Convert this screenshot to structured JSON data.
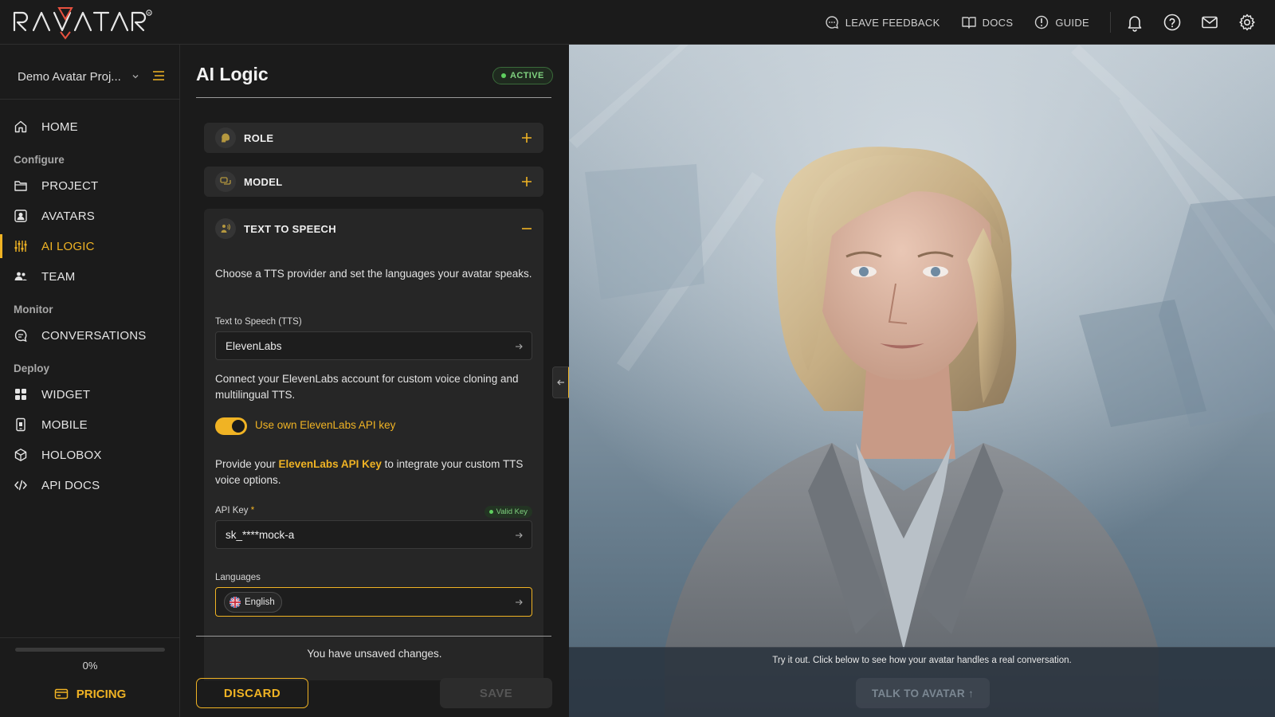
{
  "brand": {
    "logo_text": "RAVATAR",
    "accent": "#f0b324"
  },
  "topnav": {
    "feedback": "LEAVE FEEDBACK",
    "docs": "DOCS",
    "guide": "GUIDE",
    "icons": [
      "bell-icon",
      "help-icon",
      "mail-icon",
      "gear-icon"
    ]
  },
  "sidebar": {
    "project": "Demo Avatar Proj...",
    "home": "HOME",
    "sections": {
      "configure": "Configure",
      "monitor": "Monitor",
      "deploy": "Deploy"
    },
    "items": {
      "project": "PROJECT",
      "avatars": "AVATARS",
      "ai_logic": "AI LOGIC",
      "team": "TEAM",
      "conversations": "CONVERSATIONS",
      "widget": "WIDGET",
      "mobile": "MOBILE",
      "holobox": "HOLOBOX",
      "api_docs": "API DOCS"
    },
    "progress_value": 0,
    "progress_label": "0%",
    "pricing": "PRICING"
  },
  "panel": {
    "title": "AI Logic",
    "status": "ACTIVE",
    "role": "ROLE",
    "model": "MODEL",
    "tts": {
      "title": "TEXT TO SPEECH",
      "intro": "Choose a TTS provider and set the languages your avatar speaks.",
      "provider_label": "Text to Speech (TTS)",
      "provider_value": "ElevenLabs",
      "connect_text": "Connect your ElevenLabs account for custom voice cloning and multilingual TTS.",
      "toggle_label": "Use own ElevenLabs API key",
      "toggle_on": true,
      "provide_pre": "Provide your ",
      "provide_link": "ElevenLabs API Key",
      "provide_post": " to integrate your custom TTS voice options.",
      "api_key_label": "API Key",
      "required_mark": "*",
      "valid_badge": "Valid Key",
      "api_key_value": "sk_****mock-a",
      "languages_label": "Languages",
      "language_chip": "English"
    },
    "unsaved": "You have unsaved changes.",
    "discard": "DISCARD",
    "save": "SAVE"
  },
  "viewer": {
    "hint": "Try it out. Click below to see how your avatar handles a real conversation.",
    "talk": "TALK TO AVATAR ↑"
  }
}
